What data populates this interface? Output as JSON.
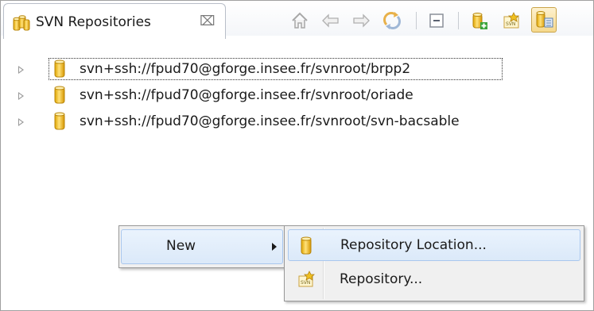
{
  "view": {
    "tab_title": "SVN Repositories",
    "close_glyph": "⌧"
  },
  "toolbar": {
    "icons": [
      "home-icon",
      "back-arrow-icon",
      "forward-arrow-icon",
      "sync-icon",
      "collapse-all-icon",
      "new-repository-location-icon",
      "new-svn-repository-icon",
      "show-repository-info-icon"
    ]
  },
  "tree": {
    "items": [
      {
        "label": "svn+ssh://fpud70@gforge.insee.fr/svnroot/brpp2",
        "focused": true
      },
      {
        "label": "svn+ssh://fpud70@gforge.insee.fr/svnroot/oriade",
        "focused": false
      },
      {
        "label": "svn+ssh://fpud70@gforge.insee.fr/svnroot/svn-bacsable",
        "focused": false
      }
    ]
  },
  "context_menu": {
    "items": [
      {
        "label": "New",
        "has_submenu": true
      }
    ]
  },
  "submenu": {
    "items": [
      {
        "label": "Repository Location...",
        "icon": "repository-location-icon",
        "highlighted": true
      },
      {
        "label": "Repository...",
        "icon": "svn-repository-icon",
        "highlighted": false
      }
    ]
  },
  "colors": {
    "cylinder_fill": "#f5c83a",
    "cylinder_stroke": "#b8860b",
    "menu_highlight": "#dbe9f9"
  }
}
